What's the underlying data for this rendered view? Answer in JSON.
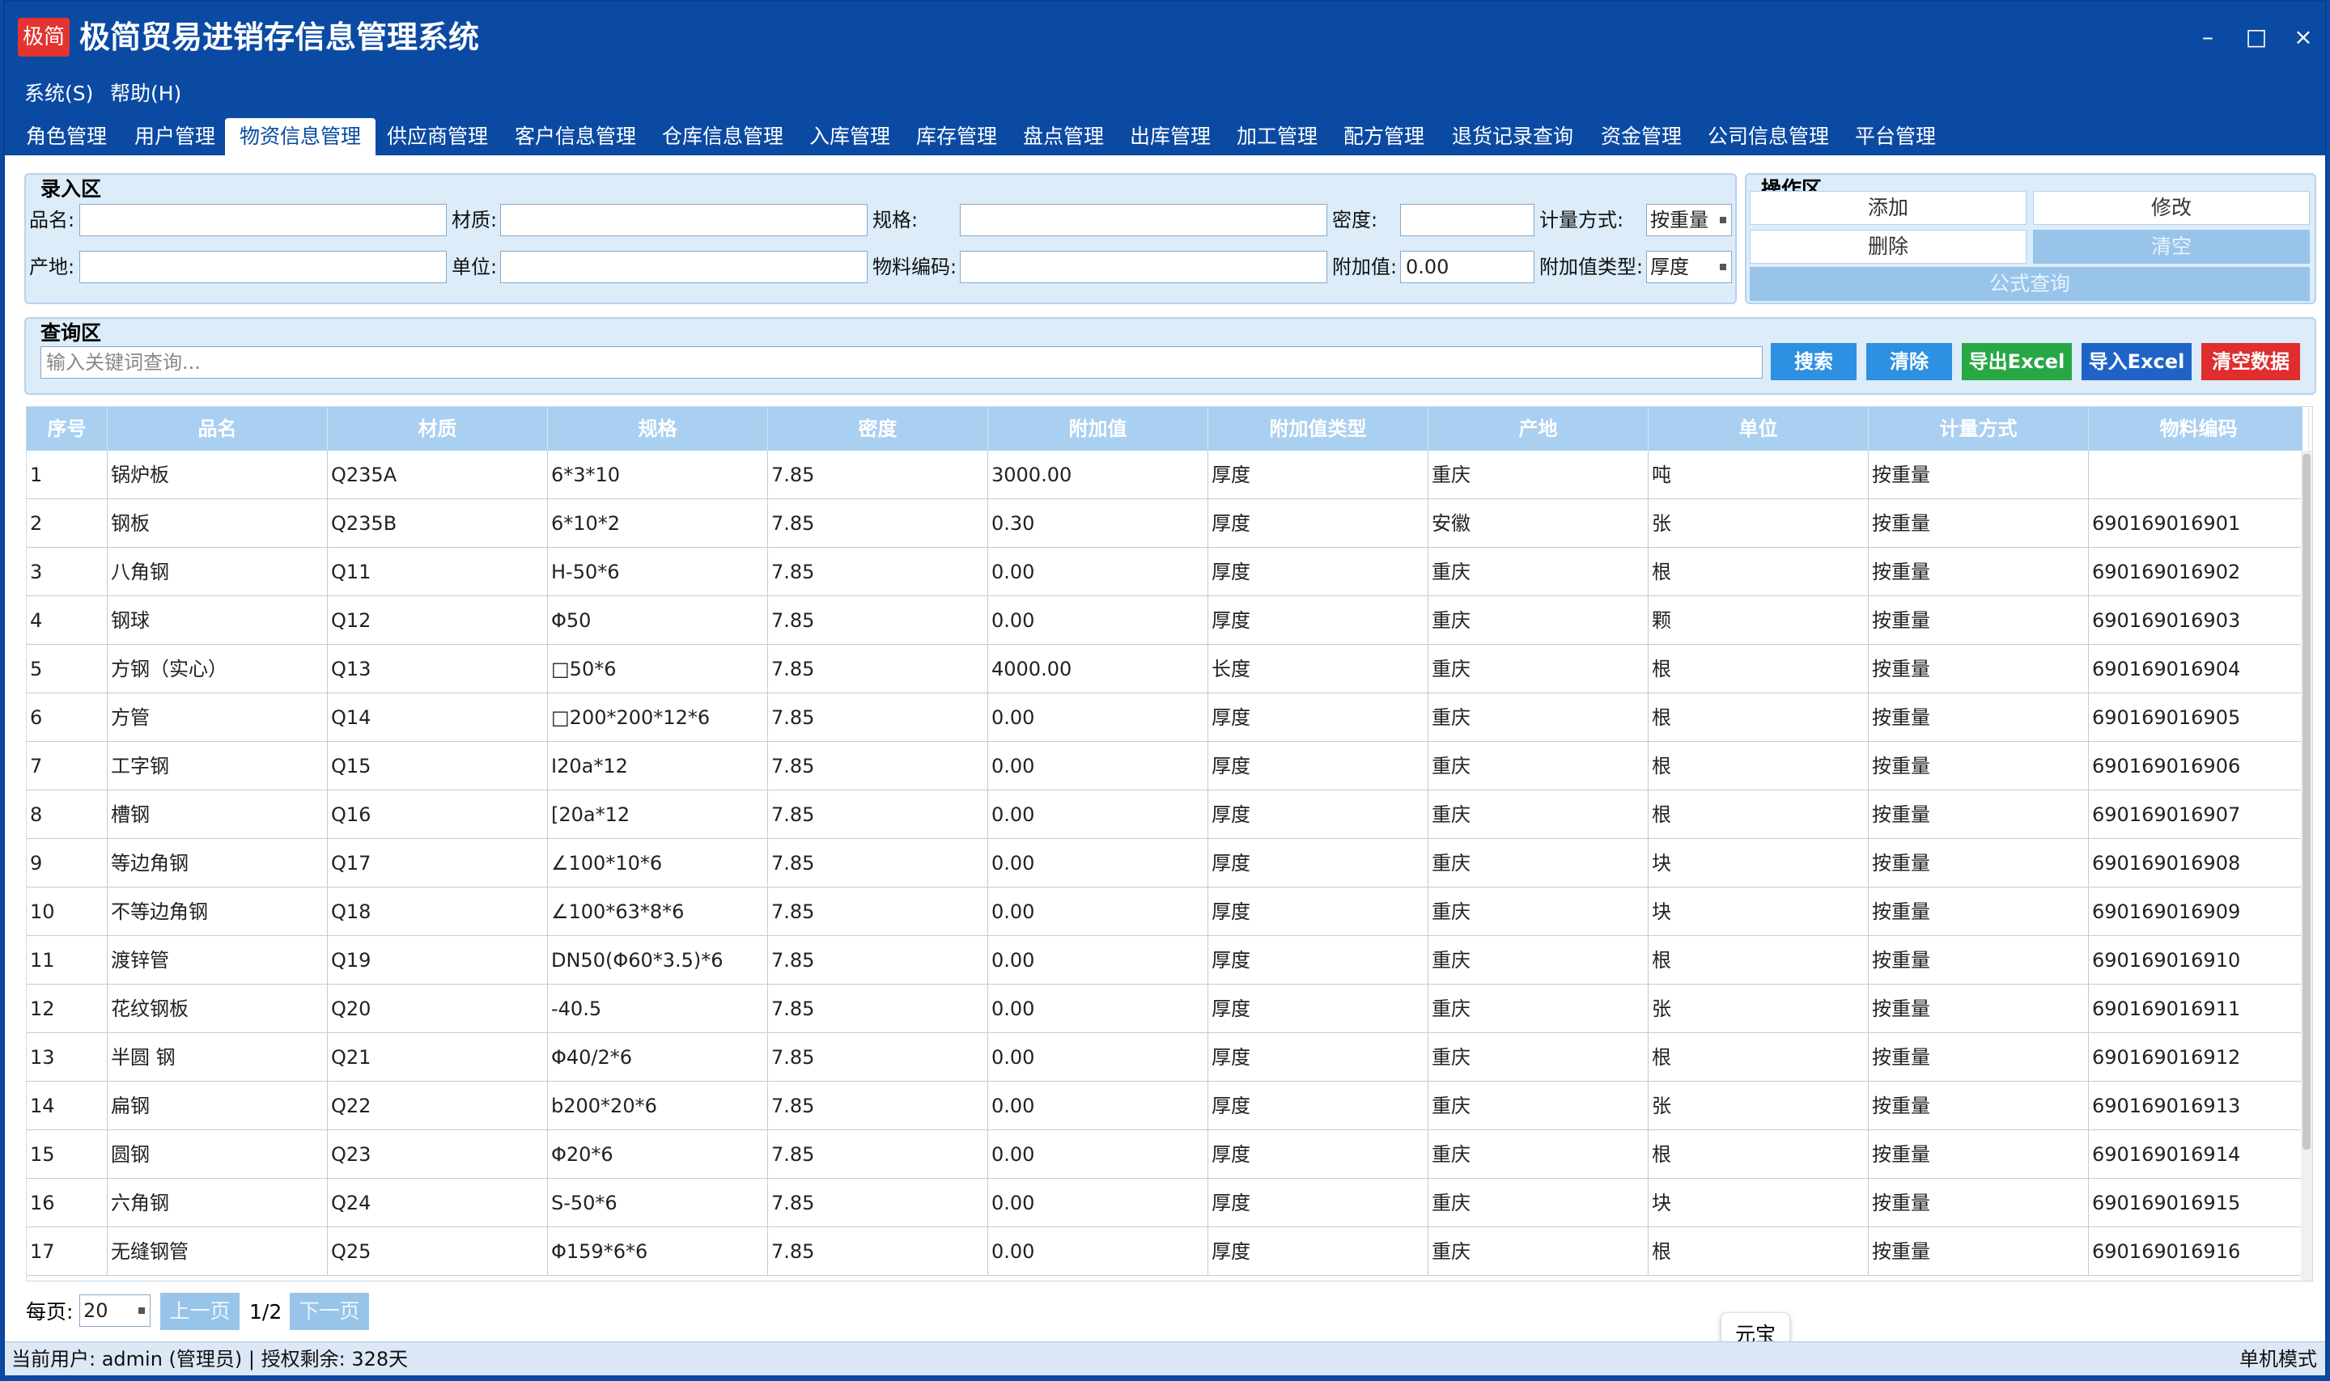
{
  "app": {
    "logo_text": "极简",
    "title": "极简贸易进销存信息管理系统",
    "minimize": "–",
    "maximize": "□",
    "close": "×"
  },
  "menu": [
    "系统(S)",
    "帮助(H)"
  ],
  "tabs": [
    "角色管理",
    "用户管理",
    "物资信息管理",
    "供应商管理",
    "客户信息管理",
    "仓库信息管理",
    "入库管理",
    "库存管理",
    "盘点管理",
    "出库管理",
    "加工管理",
    "配方管理",
    "退货记录查询",
    "资金管理",
    "公司信息管理",
    "平台管理"
  ],
  "active_tab": "物资信息管理",
  "entry": {
    "title": "录入区",
    "name_label": "品名:",
    "material_label": "材质:",
    "spec_label": "规格:",
    "density_label": "密度:",
    "measure_label": "计量方式:",
    "measure_value": "按重量",
    "origin_label": "产地:",
    "unit_label": "单位:",
    "code_label": "物料编码:",
    "addval_label": "附加值:",
    "addval_value": "0.00",
    "addtype_label": "附加值类型:",
    "addtype_value": "厚度"
  },
  "ops": {
    "title": "操作区",
    "add": "添加",
    "edit": "修改",
    "delete": "删除",
    "clear": "清空",
    "formula": "公式查询"
  },
  "query": {
    "title": "查询区",
    "placeholder": "输入关键词查询...",
    "search": "搜索",
    "reset": "清除",
    "export": "导出Excel",
    "import": "导入Excel",
    "clear_data": "清空数据"
  },
  "colors": {
    "search": "#2e90e2",
    "reset": "#2e90e2",
    "export": "#28a745",
    "import": "#1f63c7",
    "clear_data": "#e02d2d"
  },
  "columns": [
    "序号",
    "品名",
    "材质",
    "规格",
    "密度",
    "附加值",
    "附加值类型",
    "产地",
    "单位",
    "计量方式",
    "物料编码"
  ],
  "rows": [
    [
      "1",
      "锅炉板",
      "Q235A",
      "6*3*10",
      "7.85",
      "3000.00",
      "厚度",
      "重庆",
      "吨",
      "按重量",
      ""
    ],
    [
      "2",
      "钢板",
      "Q235B",
      "6*10*2",
      "7.85",
      "0.30",
      "厚度",
      "安徽",
      "张",
      "按重量",
      "690169016901"
    ],
    [
      "3",
      "八角钢",
      "Q11",
      "H-50*6",
      "7.85",
      "0.00",
      "厚度",
      "重庆",
      "根",
      "按重量",
      "690169016902"
    ],
    [
      "4",
      "钢球",
      "Q12",
      "Φ50",
      "7.85",
      "0.00",
      "厚度",
      "重庆",
      "颗",
      "按重量",
      "690169016903"
    ],
    [
      "5",
      "方钢（实心）",
      "Q13",
      "□50*6",
      "7.85",
      "4000.00",
      "长度",
      "重庆",
      "根",
      "按重量",
      "690169016904"
    ],
    [
      "6",
      "方管",
      "Q14",
      "□200*200*12*6",
      "7.85",
      "0.00",
      "厚度",
      "重庆",
      "根",
      "按重量",
      "690169016905"
    ],
    [
      "7",
      "工字钢",
      "Q15",
      "I20a*12",
      "7.85",
      "0.00",
      "厚度",
      "重庆",
      "根",
      "按重量",
      "690169016906"
    ],
    [
      "8",
      "槽钢",
      "Q16",
      "[20a*12",
      "7.85",
      "0.00",
      "厚度",
      "重庆",
      "根",
      "按重量",
      "690169016907"
    ],
    [
      "9",
      "等边角钢",
      "Q17",
      "∠100*10*6",
      "7.85",
      "0.00",
      "厚度",
      "重庆",
      "块",
      "按重量",
      "690169016908"
    ],
    [
      "10",
      "不等边角钢",
      "Q18",
      "∠100*63*8*6",
      "7.85",
      "0.00",
      "厚度",
      "重庆",
      "块",
      "按重量",
      "690169016909"
    ],
    [
      "11",
      "渡锌管",
      "Q19",
      "DN50(Φ60*3.5)*6",
      "7.85",
      "0.00",
      "厚度",
      "重庆",
      "根",
      "按重量",
      "690169016910"
    ],
    [
      "12",
      "花纹钢板",
      "Q20",
      "-40.5",
      "7.85",
      "0.00",
      "厚度",
      "重庆",
      "张",
      "按重量",
      "690169016911"
    ],
    [
      "13",
      "半圆 钢",
      "Q21",
      "Φ40/2*6",
      "7.85",
      "0.00",
      "厚度",
      "重庆",
      "根",
      "按重量",
      "690169016912"
    ],
    [
      "14",
      "扁钢",
      "Q22",
      "b200*20*6",
      "7.85",
      "0.00",
      "厚度",
      "重庆",
      "张",
      "按重量",
      "690169016913"
    ],
    [
      "15",
      "圆钢",
      "Q23",
      "Φ20*6",
      "7.85",
      "0.00",
      "厚度",
      "重庆",
      "根",
      "按重量",
      "690169016914"
    ],
    [
      "16",
      "六角钢",
      "Q24",
      "S-50*6",
      "7.85",
      "0.00",
      "厚度",
      "重庆",
      "块",
      "按重量",
      "690169016915"
    ],
    [
      "17",
      "无缝钢管",
      "Q25",
      "Φ159*6*6",
      "7.85",
      "0.00",
      "厚度",
      "重庆",
      "根",
      "按重量",
      "690169016916"
    ]
  ],
  "pager": {
    "per_page_label": "每页:",
    "per_page": "20",
    "prev": "上一页",
    "page": "1/2",
    "next": "下一页"
  },
  "tooltip": "元宝",
  "status": {
    "user": "当前用户: admin (管理员)  |  授权剩余: 328天",
    "mode": "单机模式"
  }
}
